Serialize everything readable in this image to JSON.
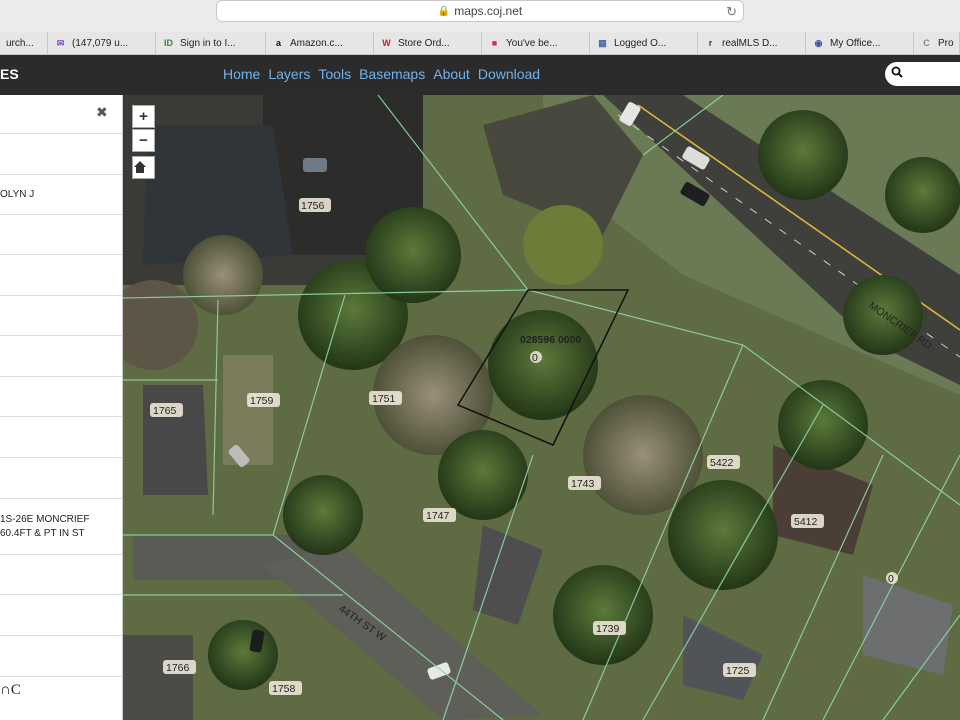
{
  "browser": {
    "url": "maps.coj.net",
    "bookmarks": [
      {
        "label": "urch...",
        "icon": "folder-icon",
        "color": "#888888"
      },
      {
        "label": "(147,079 u...",
        "icon": "mail-icon",
        "color": "#7b4fc9"
      },
      {
        "label": "Sign in to I...",
        "icon": "id-icon",
        "color": "#2e8b3a"
      },
      {
        "label": "Amazon.c...",
        "icon": "amazon-icon",
        "color": "#111111"
      },
      {
        "label": "Store Ord...",
        "icon": "walgreens-icon",
        "color": "#d11a2a"
      },
      {
        "label": "You've be...",
        "icon": "app-icon",
        "color": "#d62a4a"
      },
      {
        "label": "Logged O...",
        "icon": "grid-icon",
        "color": "#4a6fa5"
      },
      {
        "label": "realMLS D...",
        "icon": "realmls-icon",
        "color": "#1e3c7a"
      },
      {
        "label": "My Office...",
        "icon": "shield-icon",
        "color": "#3a5aa8"
      },
      {
        "label": "Pro",
        "icon": "c-icon",
        "color": "#888888"
      }
    ]
  },
  "app": {
    "logo_fragment": "ES",
    "nav": [
      "Home",
      "Layers",
      "Tools",
      "Basemaps",
      "About",
      "Download"
    ],
    "accent": "#6fb3ee"
  },
  "side_panel": {
    "owner_fragment": "OLYN J",
    "legal_line1": "1S-26E MONCRIEF",
    "legal_line2": "60.4FT & PT IN ST",
    "footer_fragment": "∩C"
  },
  "map": {
    "parcel_id": "028596 0000",
    "parcel_zero": "0",
    "street_moncrief": "MONCRIEF RD",
    "street_44th": "44TH ST W",
    "addresses": [
      "1756",
      "1765",
      "1759",
      "1751",
      "1743",
      "1747",
      "5422",
      "5412",
      "0",
      "1739",
      "1725",
      "1766",
      "1758"
    ]
  }
}
